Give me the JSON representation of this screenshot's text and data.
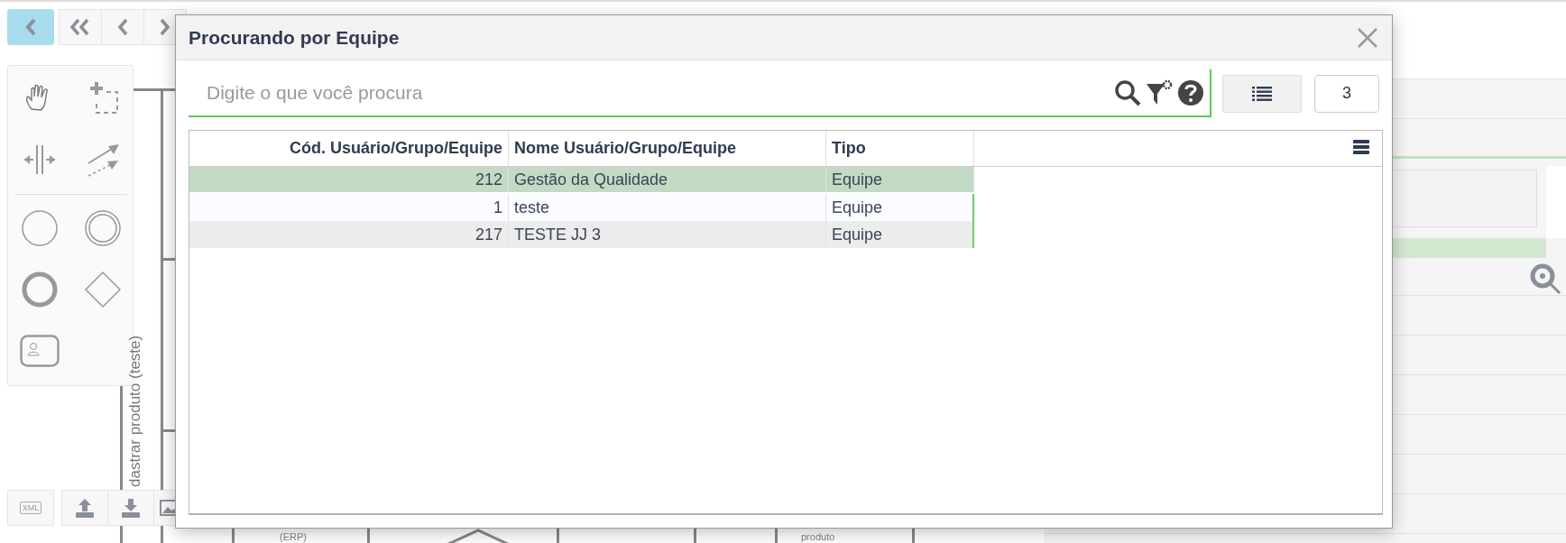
{
  "toolbar": [
    {
      "kind": "back",
      "selected": true
    },
    {
      "kind": "first",
      "selected": false
    },
    {
      "kind": "prev",
      "selected": false
    },
    {
      "kind": "next",
      "selected": false
    }
  ],
  "palette": [
    {
      "kind": "hand"
    },
    {
      "kind": "lasso"
    },
    {
      "kind": "space"
    },
    {
      "kind": "connect"
    },
    {
      "kind": "divider"
    },
    {
      "kind": "start"
    },
    {
      "kind": "intermediate"
    },
    {
      "kind": "end"
    },
    {
      "kind": "gateway"
    },
    {
      "kind": "task"
    }
  ],
  "canvas": {
    "lane_label": "dastrar produto (teste)",
    "texts": [
      "(ERP)",
      "produto"
    ]
  },
  "bottom_tools": [
    {
      "kind": "xml",
      "label": "XML"
    },
    {
      "kind": "upload"
    },
    {
      "kind": "download"
    },
    {
      "kind": "image"
    }
  ],
  "dialog": {
    "title": "Procurando por Equipe",
    "search": {
      "placeholder": "Digite o que você procura"
    },
    "count": "3",
    "table": {
      "columns": [
        "Cód. Usuário/Grupo/Equipe",
        "Nome Usuário/Grupo/Equipe",
        "Tipo"
      ],
      "rows": [
        {
          "cells": [
            "212",
            "Gestão da Qualidade",
            "Equipe"
          ],
          "selected": true
        },
        {
          "cells": [
            "1",
            "teste",
            "Equipe"
          ],
          "selected": false
        },
        {
          "cells": [
            "217",
            "TESTE JJ 3",
            "Equipe"
          ],
          "selected": false
        }
      ]
    }
  }
}
